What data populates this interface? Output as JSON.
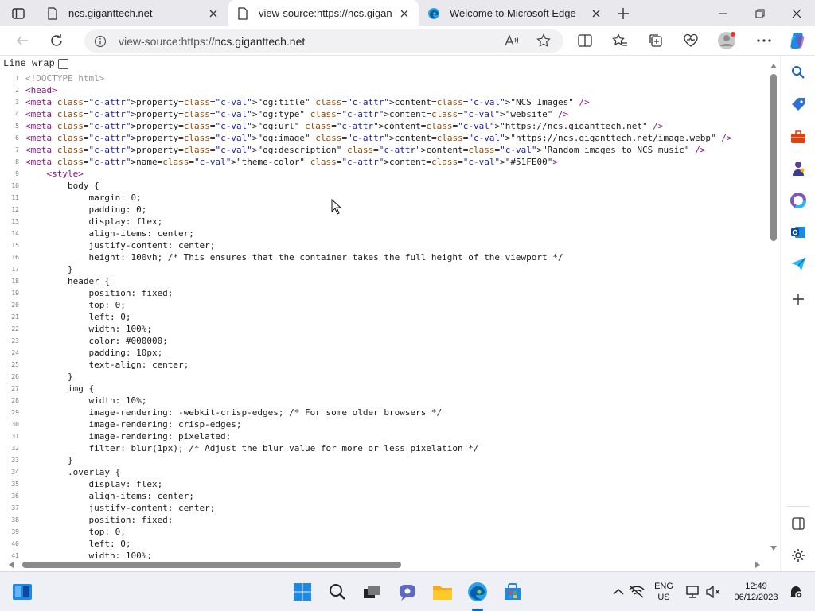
{
  "browser": {
    "tabs": [
      {
        "title": "ncs.giganttech.net",
        "active": false
      },
      {
        "title": "view-source:https://ncs.giganttech.net",
        "active": true
      },
      {
        "title": "Welcome to Microsoft Edge",
        "active": false
      }
    ],
    "address": {
      "prefix": "view-source:https://",
      "domain": "ncs.giganttech.net"
    }
  },
  "viewer": {
    "line_wrap_label": "Line wrap",
    "line_wrap_checked": false
  },
  "source_lines": [
    {
      "n": "1",
      "t": "<!DOCTYPE html>"
    },
    {
      "n": "2",
      "t": "<head>"
    },
    {
      "n": "3",
      "t": "<meta property=\"og:title\" content=\"NCS Images\" />"
    },
    {
      "n": "4",
      "t": "<meta property=\"og:type\" content=\"website\" />"
    },
    {
      "n": "5",
      "t": "<meta property=\"og:url\" content=\"https://ncs.giganttech.net\" />"
    },
    {
      "n": "6",
      "t": "<meta property=\"og:image\" content=\"https://ncs.giganttech.net/image.webp\" />"
    },
    {
      "n": "7",
      "t": "<meta property=\"og:description\" content=\"Random images to NCS music\" />"
    },
    {
      "n": "8",
      "t": "<meta name=\"theme-color\" content=\"#51FE00\">"
    },
    {
      "n": "9",
      "t": "    <style>"
    },
    {
      "n": "10",
      "t": "        body {"
    },
    {
      "n": "11",
      "t": "            margin: 0;"
    },
    {
      "n": "12",
      "t": "            padding: 0;"
    },
    {
      "n": "13",
      "t": "            display: flex;"
    },
    {
      "n": "14",
      "t": "            align-items: center;"
    },
    {
      "n": "15",
      "t": "            justify-content: center;"
    },
    {
      "n": "16",
      "t": "            height: 100vh; /* This ensures that the container takes the full height of the viewport */"
    },
    {
      "n": "17",
      "t": "        }"
    },
    {
      "n": "18",
      "t": "        header {"
    },
    {
      "n": "19",
      "t": "            position: fixed;"
    },
    {
      "n": "20",
      "t": "            top: 0;"
    },
    {
      "n": "21",
      "t": "            left: 0;"
    },
    {
      "n": "22",
      "t": "            width: 100%;"
    },
    {
      "n": "23",
      "t": "            color: #000000;"
    },
    {
      "n": "24",
      "t": "            padding: 10px;"
    },
    {
      "n": "25",
      "t": "            text-align: center;"
    },
    {
      "n": "26",
      "t": "        }"
    },
    {
      "n": "27",
      "t": "        img {"
    },
    {
      "n": "28",
      "t": "            width: 10%;"
    },
    {
      "n": "29",
      "t": "            image-rendering: -webkit-crisp-edges; /* For some older browsers */"
    },
    {
      "n": "30",
      "t": "            image-rendering: crisp-edges;"
    },
    {
      "n": "31",
      "t": "            image-rendering: pixelated;"
    },
    {
      "n": "32",
      "t": "            filter: blur(1px); /* Adjust the blur value for more or less pixelation */"
    },
    {
      "n": "33",
      "t": "        }"
    },
    {
      "n": "34",
      "t": "        .overlay {"
    },
    {
      "n": "35",
      "t": "            display: flex;"
    },
    {
      "n": "36",
      "t": "            align-items: center;"
    },
    {
      "n": "37",
      "t": "            justify-content: center;"
    },
    {
      "n": "38",
      "t": "            position: fixed;"
    },
    {
      "n": "39",
      "t": "            top: 0;"
    },
    {
      "n": "40",
      "t": "            left: 0;"
    },
    {
      "n": "41",
      "t": "            width: 100%;"
    }
  ],
  "taskbar": {
    "language": "ENG",
    "region": "US",
    "time": "12:49",
    "date": "06/12/2023"
  },
  "colors": {
    "edge_blue": "#0a64d0",
    "tag": "#881280",
    "attr": "#994500",
    "value": "#1a1aa6"
  }
}
